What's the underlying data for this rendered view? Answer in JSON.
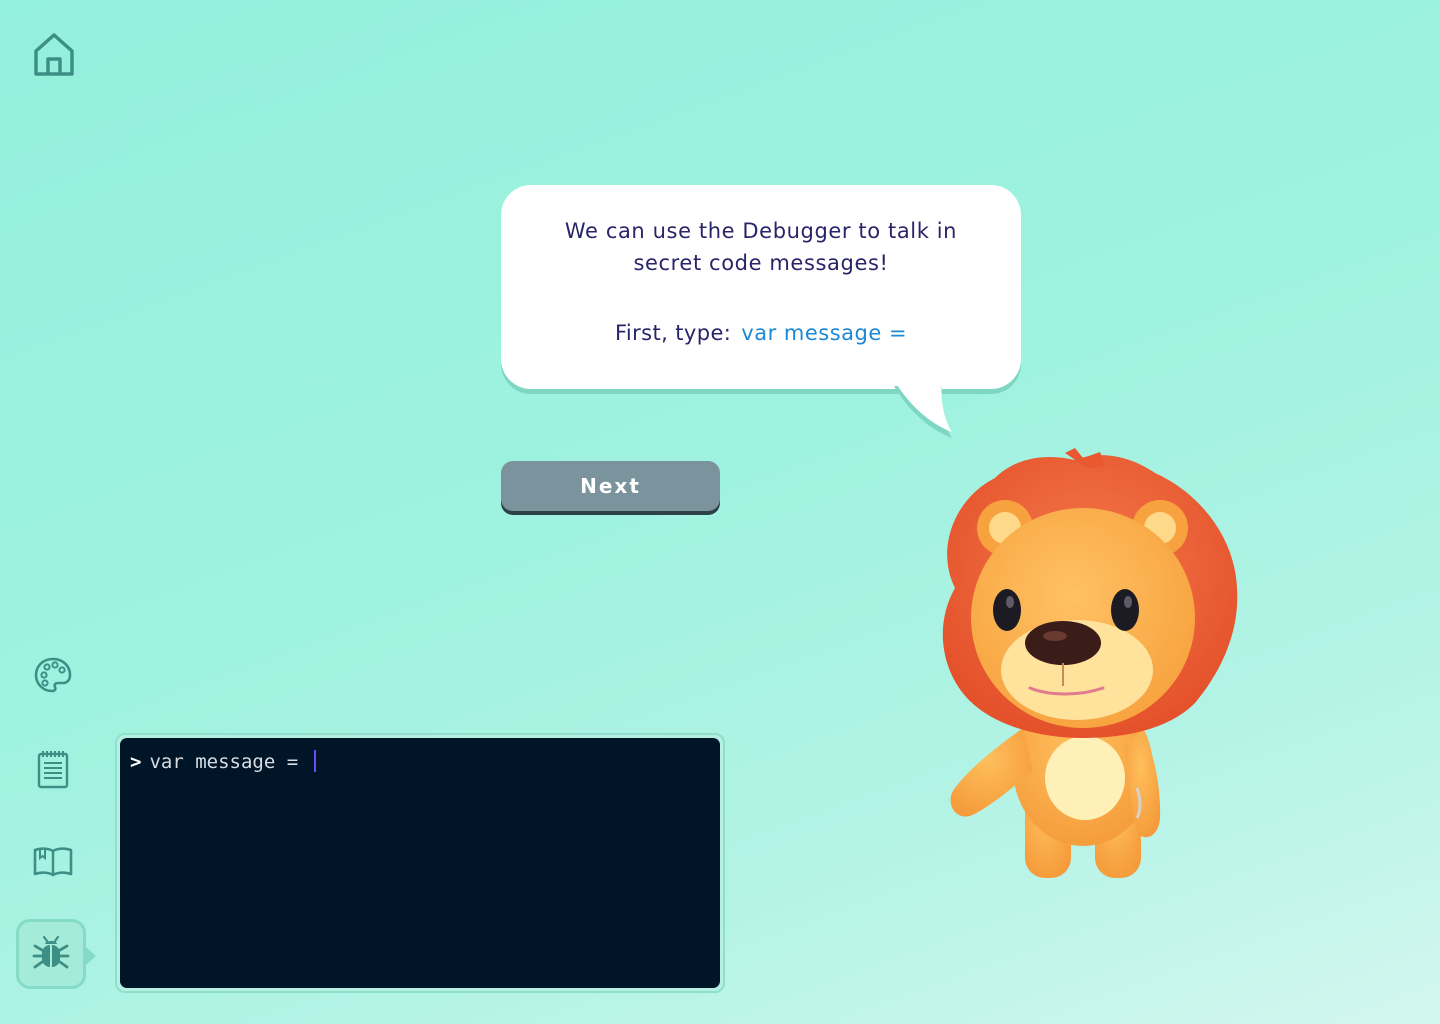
{
  "nav": {
    "home_icon": "home-icon",
    "palette_icon": "palette-icon",
    "notepad_icon": "notepad-icon",
    "book_icon": "book-icon",
    "debugger_icon": "bug-icon"
  },
  "bubble": {
    "message": "We can use the Debugger to talk in secret code messages!",
    "instruction_label": "First, type:",
    "instruction_code": "var message ="
  },
  "next_button": {
    "label": "Next"
  },
  "console": {
    "prompt": ">",
    "input": "var message = "
  },
  "character": {
    "name": "lion"
  },
  "colors": {
    "background": "#9ef2df",
    "bubble_text": "#2a2468",
    "code_highlight": "#1e88d6",
    "button": "#7b939c",
    "console_bg": "#001528",
    "cursor": "#6a4cff"
  }
}
